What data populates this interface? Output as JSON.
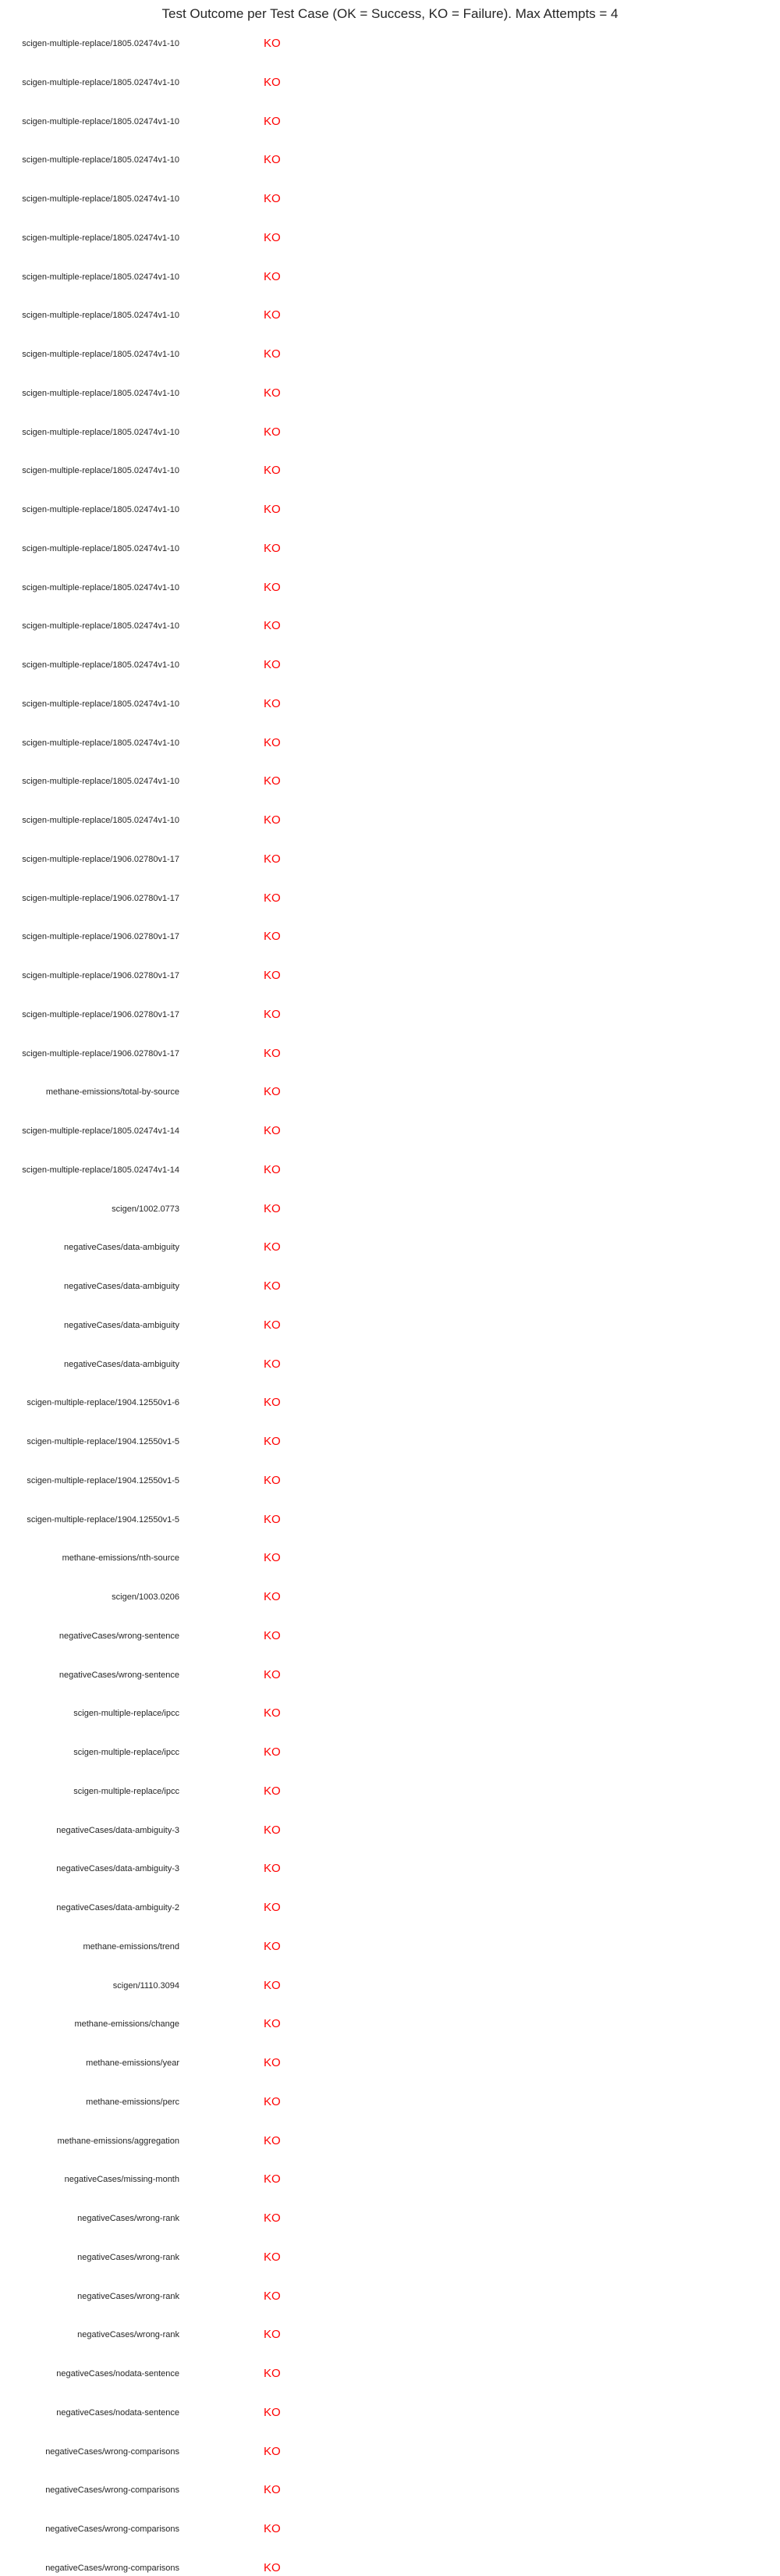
{
  "chart_data": {
    "type": "table",
    "title": "Test Outcome per Test Case (OK = Success, KO = Failure). Max Attempts = 4",
    "columns": [
      "test_case",
      "outcome"
    ],
    "colors": {
      "KO": "#ff0000",
      "OK": "#008000"
    },
    "rows": [
      {
        "test_case": "scigen-multiple-replace/1805.02474v1-10",
        "outcome": "KO"
      },
      {
        "test_case": "scigen-multiple-replace/1805.02474v1-10",
        "outcome": "KO"
      },
      {
        "test_case": "scigen-multiple-replace/1805.02474v1-10",
        "outcome": "KO"
      },
      {
        "test_case": "scigen-multiple-replace/1805.02474v1-10",
        "outcome": "KO"
      },
      {
        "test_case": "scigen-multiple-replace/1805.02474v1-10",
        "outcome": "KO"
      },
      {
        "test_case": "scigen-multiple-replace/1805.02474v1-10",
        "outcome": "KO"
      },
      {
        "test_case": "scigen-multiple-replace/1805.02474v1-10",
        "outcome": "KO"
      },
      {
        "test_case": "scigen-multiple-replace/1805.02474v1-10",
        "outcome": "KO"
      },
      {
        "test_case": "scigen-multiple-replace/1805.02474v1-10",
        "outcome": "KO"
      },
      {
        "test_case": "scigen-multiple-replace/1805.02474v1-10",
        "outcome": "KO"
      },
      {
        "test_case": "scigen-multiple-replace/1805.02474v1-10",
        "outcome": "KO"
      },
      {
        "test_case": "scigen-multiple-replace/1805.02474v1-10",
        "outcome": "KO"
      },
      {
        "test_case": "scigen-multiple-replace/1805.02474v1-10",
        "outcome": "KO"
      },
      {
        "test_case": "scigen-multiple-replace/1805.02474v1-10",
        "outcome": "KO"
      },
      {
        "test_case": "scigen-multiple-replace/1805.02474v1-10",
        "outcome": "KO"
      },
      {
        "test_case": "scigen-multiple-replace/1805.02474v1-10",
        "outcome": "KO"
      },
      {
        "test_case": "scigen-multiple-replace/1805.02474v1-10",
        "outcome": "KO"
      },
      {
        "test_case": "scigen-multiple-replace/1805.02474v1-10",
        "outcome": "KO"
      },
      {
        "test_case": "scigen-multiple-replace/1805.02474v1-10",
        "outcome": "KO"
      },
      {
        "test_case": "scigen-multiple-replace/1805.02474v1-10",
        "outcome": "KO"
      },
      {
        "test_case": "scigen-multiple-replace/1805.02474v1-10",
        "outcome": "KO"
      },
      {
        "test_case": "scigen-multiple-replace/1906.02780v1-17",
        "outcome": "KO"
      },
      {
        "test_case": "scigen-multiple-replace/1906.02780v1-17",
        "outcome": "KO"
      },
      {
        "test_case": "scigen-multiple-replace/1906.02780v1-17",
        "outcome": "KO"
      },
      {
        "test_case": "scigen-multiple-replace/1906.02780v1-17",
        "outcome": "KO"
      },
      {
        "test_case": "scigen-multiple-replace/1906.02780v1-17",
        "outcome": "KO"
      },
      {
        "test_case": "scigen-multiple-replace/1906.02780v1-17",
        "outcome": "KO"
      },
      {
        "test_case": "methane-emissions/total-by-source",
        "outcome": "KO"
      },
      {
        "test_case": "scigen-multiple-replace/1805.02474v1-14",
        "outcome": "KO"
      },
      {
        "test_case": "scigen-multiple-replace/1805.02474v1-14",
        "outcome": "KO"
      },
      {
        "test_case": "scigen/1002.0773",
        "outcome": "KO"
      },
      {
        "test_case": "negativeCases/data-ambiguity",
        "outcome": "KO"
      },
      {
        "test_case": "negativeCases/data-ambiguity",
        "outcome": "KO"
      },
      {
        "test_case": "negativeCases/data-ambiguity",
        "outcome": "KO"
      },
      {
        "test_case": "negativeCases/data-ambiguity",
        "outcome": "KO"
      },
      {
        "test_case": "scigen-multiple-replace/1904.12550v1-6",
        "outcome": "KO"
      },
      {
        "test_case": "scigen-multiple-replace/1904.12550v1-5",
        "outcome": "KO"
      },
      {
        "test_case": "scigen-multiple-replace/1904.12550v1-5",
        "outcome": "KO"
      },
      {
        "test_case": "scigen-multiple-replace/1904.12550v1-5",
        "outcome": "KO"
      },
      {
        "test_case": "methane-emissions/nth-source",
        "outcome": "KO"
      },
      {
        "test_case": "scigen/1003.0206",
        "outcome": "KO"
      },
      {
        "test_case": "negativeCases/wrong-sentence",
        "outcome": "KO"
      },
      {
        "test_case": "negativeCases/wrong-sentence",
        "outcome": "KO"
      },
      {
        "test_case": "scigen-multiple-replace/ipcc",
        "outcome": "KO"
      },
      {
        "test_case": "scigen-multiple-replace/ipcc",
        "outcome": "KO"
      },
      {
        "test_case": "scigen-multiple-replace/ipcc",
        "outcome": "KO"
      },
      {
        "test_case": "negativeCases/data-ambiguity-3",
        "outcome": "KO"
      },
      {
        "test_case": "negativeCases/data-ambiguity-3",
        "outcome": "KO"
      },
      {
        "test_case": "negativeCases/data-ambiguity-2",
        "outcome": "KO"
      },
      {
        "test_case": "methane-emissions/trend",
        "outcome": "KO"
      },
      {
        "test_case": "scigen/1110.3094",
        "outcome": "KO"
      },
      {
        "test_case": "methane-emissions/change",
        "outcome": "KO"
      },
      {
        "test_case": "methane-emissions/year",
        "outcome": "KO"
      },
      {
        "test_case": "methane-emissions/perc",
        "outcome": "KO"
      },
      {
        "test_case": "methane-emissions/aggregation",
        "outcome": "KO"
      },
      {
        "test_case": "negativeCases/missing-month",
        "outcome": "KO"
      },
      {
        "test_case": "negativeCases/wrong-rank",
        "outcome": "KO"
      },
      {
        "test_case": "negativeCases/wrong-rank",
        "outcome": "KO"
      },
      {
        "test_case": "negativeCases/wrong-rank",
        "outcome": "KO"
      },
      {
        "test_case": "negativeCases/wrong-rank",
        "outcome": "KO"
      },
      {
        "test_case": "negativeCases/nodata-sentence",
        "outcome": "KO"
      },
      {
        "test_case": "negativeCases/nodata-sentence",
        "outcome": "KO"
      },
      {
        "test_case": "negativeCases/wrong-comparisons",
        "outcome": "KO"
      },
      {
        "test_case": "negativeCases/wrong-comparisons",
        "outcome": "KO"
      },
      {
        "test_case": "negativeCases/wrong-comparisons",
        "outcome": "KO"
      },
      {
        "test_case": "negativeCases/wrong-comparisons",
        "outcome": "KO"
      }
    ]
  }
}
